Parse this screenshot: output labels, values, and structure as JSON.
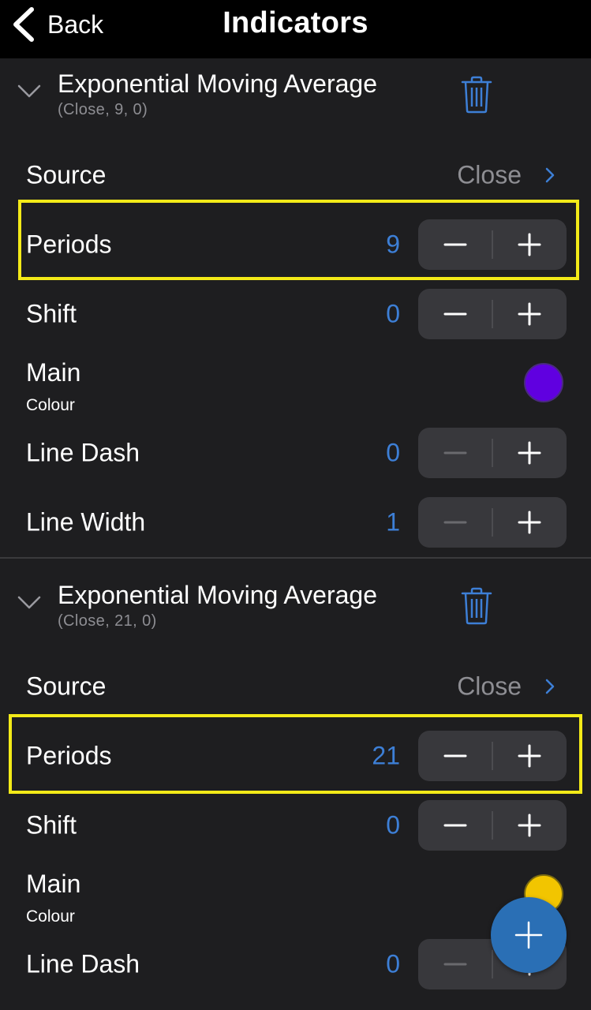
{
  "nav": {
    "back_label": "Back",
    "title": "Indicators"
  },
  "indicators": [
    {
      "title": "Exponential Moving Average",
      "subtitle": "(Close, 9, 0)",
      "source_label": "Source",
      "source_value": "Close",
      "periods_label": "Periods",
      "periods_value": "9",
      "shift_label": "Shift",
      "shift_value": "0",
      "main_label": "Main",
      "colour_label": "Colour",
      "colour": "#6000e0",
      "line_dash_label": "Line Dash",
      "line_dash_value": "0",
      "line_width_label": "Line Width",
      "line_width_value": "1"
    },
    {
      "title": "Exponential Moving Average",
      "subtitle": "(Close, 21, 0)",
      "source_label": "Source",
      "source_value": "Close",
      "periods_label": "Periods",
      "periods_value": "21",
      "shift_label": "Shift",
      "shift_value": "0",
      "main_label": "Main",
      "colour_label": "Colour",
      "colour": "#f2c500",
      "line_dash_label": "Line Dash",
      "line_dash_value": "0"
    }
  ],
  "colors": {
    "accent": "#3d7fd6",
    "highlight": "#f3ea18",
    "background": "#1e1e20",
    "fab": "#2a6fb5"
  },
  "icons": {
    "back": "chevron-left-icon",
    "collapse": "chevron-down-icon",
    "delete": "trash-icon",
    "disclosure": "chevron-right-icon",
    "add": "plus-icon"
  }
}
